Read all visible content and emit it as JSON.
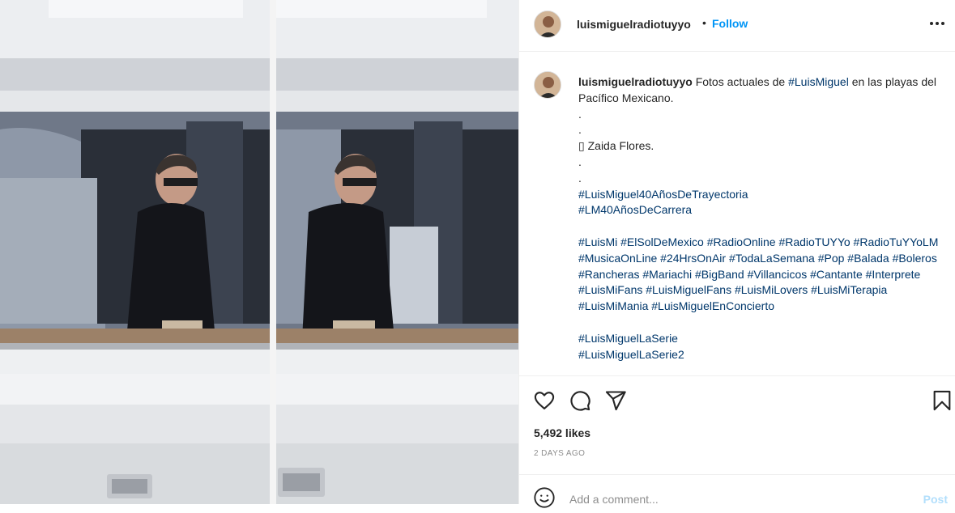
{
  "post": {
    "username": "luismiguelradiotuyyo",
    "separator": "•",
    "follow_label": "Follow",
    "caption": {
      "username": "luismiguelradiotuyyo",
      "line1_pre": "Fotos actuales de ",
      "line1_tag": "#LuisMiguel",
      "line1_post": " en las playas del Pacífico Mexicano.",
      "dots1": ".\n.",
      "credit": " Zaida Flores.",
      "dots2": ".\n.",
      "tags_block1": "#LuisMiguel40AñosDeTrayectoria\n#LM40AñosDeCarrera",
      "tags_block2": "#LuisMi #ElSolDeMexico #RadioOnline #RadioTUYYo #RadioTuYYoLM #MusicaOnLine #24HrsOnAir #TodaLaSemana #Pop #Balada #Boleros #Rancheras #Mariachi #BigBand #Villancicos #Cantante #Interprete #LuisMiFans #LuisMiguelFans #LuisMiLovers #LuisMiTerapia #LuisMiMania #LuisMiguelEnConcierto",
      "tags_block3": "#LuisMiguelLaSerie\n#LuisMiguelLaSerie2"
    },
    "likes": "5,492 likes",
    "time_ago": "2 DAYS AGO",
    "comment_placeholder": "Add a comment...",
    "post_label": "Post"
  },
  "icons": {
    "more": "more-options-icon",
    "like": "heart-icon",
    "comment": "comment-icon",
    "share": "share-icon",
    "save": "bookmark-icon",
    "emoji": "emoji-icon"
  },
  "colors": {
    "link": "#0095f6",
    "hashtag": "#00376b",
    "muted": "#8e8e8e",
    "post_disabled": "#b2dffc"
  }
}
